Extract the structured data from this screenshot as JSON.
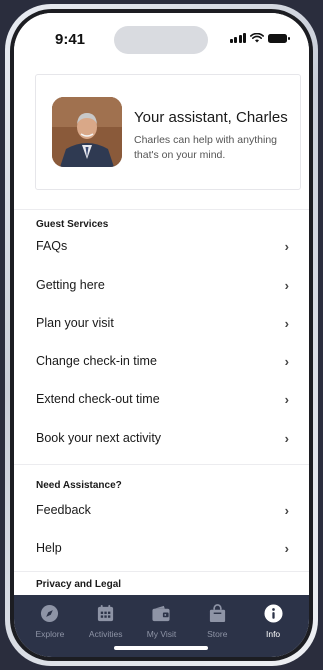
{
  "status": {
    "time": "9:41"
  },
  "assistant": {
    "title": "Your assistant, Charles",
    "subtitle": "Charles can help with anything that's on your mind."
  },
  "guest_services": {
    "heading": "Guest Services",
    "items": [
      {
        "label": "FAQs"
      },
      {
        "label": "Getting here"
      },
      {
        "label": "Plan your visit"
      },
      {
        "label": "Change check-in time"
      },
      {
        "label": "Extend check-out time"
      },
      {
        "label": "Book your next activity"
      }
    ]
  },
  "need_assistance": {
    "heading": "Need Assistance?",
    "items": [
      {
        "label": "Feedback"
      },
      {
        "label": "Help"
      }
    ]
  },
  "privacy": {
    "heading": "Privacy and Legal"
  },
  "tabbar": {
    "items": [
      {
        "label": "Explore",
        "icon": "compass-icon"
      },
      {
        "label": "Activities",
        "icon": "calendar-icon"
      },
      {
        "label": "My Visit",
        "icon": "wallet-icon"
      },
      {
        "label": "Store",
        "icon": "shopping-bag-icon"
      },
      {
        "label": "Info",
        "icon": "info-icon",
        "active": true
      }
    ]
  },
  "colors": {
    "tabbar_bg": "#2c3348",
    "tab_inactive": "#8e94a6",
    "tab_active": "#ffffff"
  }
}
